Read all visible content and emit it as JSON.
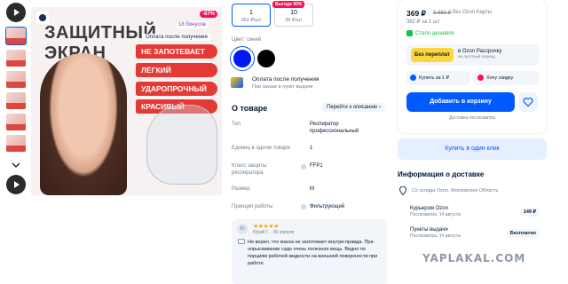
{
  "gallery": {
    "hero_title": "ЗАЩИТНЫЙ ЭКРАН",
    "discount_badge": "-87%",
    "bonus_badge": "18 бонусов",
    "pay_after_badge": "Оплата после получения",
    "features": [
      "НЕ ЗАПОТЕВАЕТ",
      "ЛЁГКИЙ",
      "УДАРОПРОЧНЫЙ",
      "КРАСИВЫЙ"
    ]
  },
  "variants": [
    {
      "qty": "1",
      "price": "362 ₽/шт"
    },
    {
      "qty": "10",
      "price": "38 ₽/шт",
      "tag": "Выгода 90%"
    }
  ],
  "color": {
    "label": "Цвет: синий",
    "swatches": [
      "#0018f5",
      "#000000"
    ]
  },
  "pay_after": {
    "title": "Оплата после получения",
    "subtitle": "При заказе в пункт выдачи"
  },
  "about": {
    "title": "О товаре",
    "link": "Перейти к описанию",
    "specs": [
      {
        "k": "Тип",
        "v": "Респиратор профессиональный"
      },
      {
        "k": "Единиц в одном товаре",
        "v": "1"
      },
      {
        "k": "Класс защиты респиратора",
        "v": "FFP1"
      },
      {
        "k": "Размер",
        "v": "M"
      },
      {
        "k": "Принцип работы",
        "v": "Фильтрующий"
      }
    ]
  },
  "review": {
    "avatar": "Ю",
    "stars": "★★★★★",
    "meta": "Юрий Г. · 30 апреля",
    "text": "Не верил, что маска не запотевает внутри-правда. При опрыскивании садо очень полезная вещь. Видно по порциям рабочей жидкости на внешней поверхности при работе."
  },
  "buy": {
    "price": "369 ₽",
    "old_price": "3 880 ₽",
    "price_note": "без Ozon Карты",
    "sub": "362 ₽ за 1 шт",
    "cheaper": "Стало дешевле",
    "promo_tag": "Без переплат",
    "promo_title": "в Ozon Рассрочку",
    "promo_sub": "на льготный период",
    "buy_one": "Купить за 1 ₽",
    "want_discount": "Хочу скидку",
    "cart": "Добавить в корзину",
    "delivery_note": "Доставка послезавтра"
  },
  "oneclick": "Купить в один клик",
  "delivery": {
    "title": "Информация о доставке",
    "location": "Со склада Ozon, Московская Область",
    "rows": [
      {
        "name": "Курьером Ozon",
        "date": "Послезавтра, 14 августа",
        "price": "149 ₽"
      },
      {
        "name": "Пункты выдачи",
        "date": "Послезавтра, 14 августа",
        "price": "Бесплатно"
      }
    ]
  },
  "watermark": "YAPLAKAL.COM",
  "colors": {
    "accent": "#005bff",
    "sale": "#f91155",
    "feature_red": "#e53935",
    "green": "#10c44c"
  }
}
